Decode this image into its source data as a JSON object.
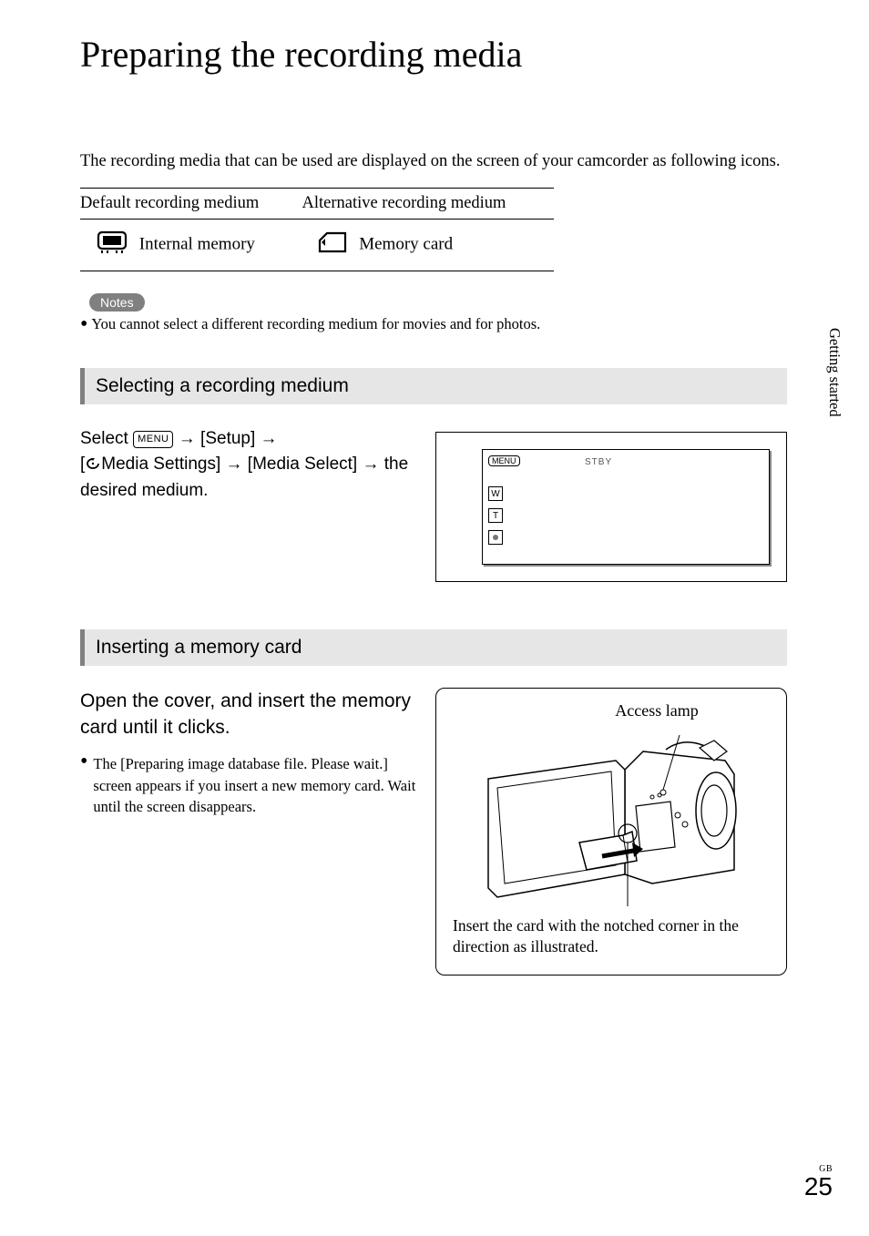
{
  "title": "Preparing the recording media",
  "intro": "The recording media that can be used are displayed on the screen of your camcorder as following icons.",
  "table": {
    "head_left": "Default recording medium",
    "head_right": "Alternative recording medium",
    "cell_left": "Internal memory",
    "cell_right": "Memory card"
  },
  "notes_label": "Notes",
  "notes_text": "You cannot select a different recording medium for movies and for photos.",
  "section1": "Selecting a recording medium",
  "instr": {
    "select": "Select ",
    "menu": "MENU",
    "setup": " [Setup] ",
    "media_settings": "Media Settings] ",
    "media_select": " [Media Select] ",
    "desired": " the desired medium."
  },
  "screen": {
    "menu": "MENU",
    "stby": "STBY",
    "w": "W",
    "t": "T"
  },
  "section2": "Inserting a memory card",
  "sub_head": "Open the cover, and insert the memory card until it clicks.",
  "bullet1": "The [Preparing image database file. Please wait.] screen appears if you insert a new memory card. Wait until the screen disappears.",
  "access_lamp": "Access lamp",
  "card_caption": "Insert the card with the notched corner in the direction as illustrated.",
  "side_tab": "Getting started",
  "gb": "GB",
  "page_num": "25"
}
